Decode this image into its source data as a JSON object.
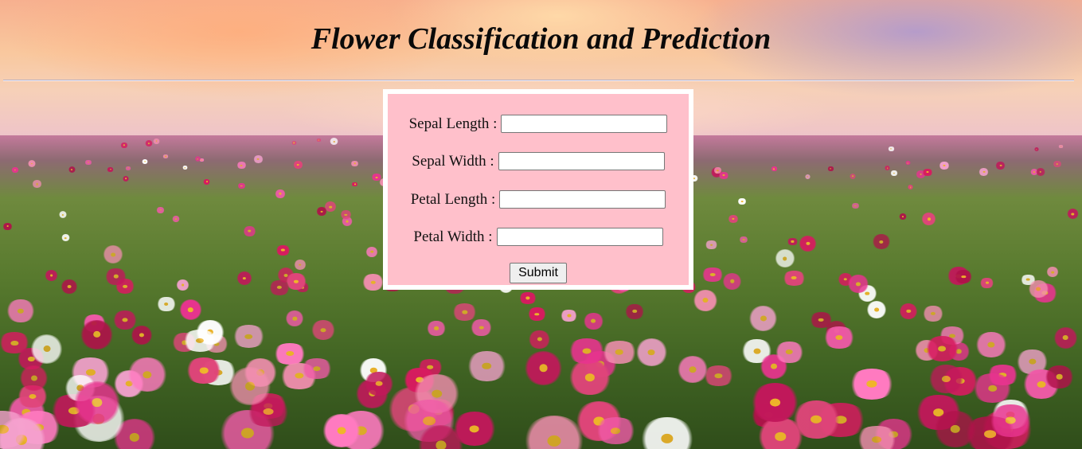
{
  "page": {
    "title": "Flower Classification and Prediction"
  },
  "form": {
    "fields": [
      {
        "label": "Sepal Length :",
        "value": ""
      },
      {
        "label": "Sepal Width :",
        "value": ""
      },
      {
        "label": "Petal Length :",
        "value": ""
      },
      {
        "label": "Petal Width :",
        "value": ""
      }
    ],
    "submit_label": "Submit"
  },
  "colors": {
    "panel_background": "#ffc0cb",
    "panel_border": "#ffffff",
    "title_color": "#0a0a0a"
  }
}
